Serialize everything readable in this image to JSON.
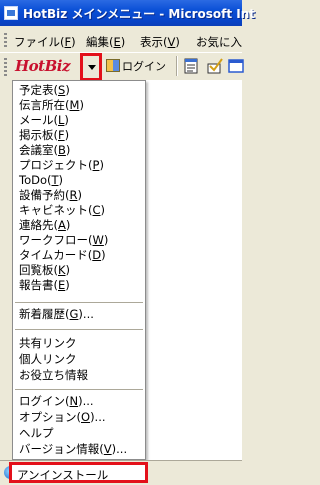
{
  "window": {
    "title": "HotBiz メインメニュー - Microsoft Int"
  },
  "menubar": {
    "items": [
      {
        "label": "ファイル(",
        "key": "F",
        "close": ")"
      },
      {
        "label": "編集(",
        "key": "E",
        "close": ")"
      },
      {
        "label": "表示(",
        "key": "V",
        "close": ")"
      },
      {
        "label": "お気に入",
        "key": "",
        "close": ""
      }
    ]
  },
  "toolbar": {
    "logo": "HotBiz",
    "login_label": "ログイン",
    "icons": [
      "notepad-icon",
      "check-icon",
      "window-icon"
    ]
  },
  "menu": {
    "groups": [
      [
        {
          "label": "予定表(",
          "key": "S",
          "close": ")"
        },
        {
          "label": "伝言所在(",
          "key": "M",
          "close": ")"
        },
        {
          "label": "メール(",
          "key": "L",
          "close": ")"
        },
        {
          "label": "掲示板(",
          "key": "F",
          "close": ")"
        },
        {
          "label": "会議室(",
          "key": "B",
          "close": ")"
        },
        {
          "label": "プロジェクト(",
          "key": "P",
          "close": ")"
        },
        {
          "label": "ToDo(",
          "key": "T",
          "close": ")"
        },
        {
          "label": "設備予約(",
          "key": "R",
          "close": ")"
        },
        {
          "label": "キャビネット(",
          "key": "C",
          "close": ")"
        },
        {
          "label": "連絡先(",
          "key": "A",
          "close": ")"
        },
        {
          "label": "ワークフロー(",
          "key": "W",
          "close": ")"
        },
        {
          "label": "タイムカード(",
          "key": "D",
          "close": ")"
        },
        {
          "label": "回覧板(",
          "key": "K",
          "close": ")"
        },
        {
          "label": "報告書(",
          "key": "E",
          "close": ")"
        }
      ],
      [
        {
          "label": "新着履歴(",
          "key": "G",
          "close": ")..."
        }
      ],
      [
        {
          "label": "共有リンク",
          "key": "",
          "close": ""
        },
        {
          "label": "個人リンク",
          "key": "",
          "close": ""
        },
        {
          "label": "お役立ち情報",
          "key": "",
          "close": ""
        }
      ],
      [
        {
          "label": "ログイン(",
          "key": "N",
          "close": ")..."
        },
        {
          "label": "オプション(",
          "key": "O",
          "close": ")..."
        },
        {
          "label": "ヘルプ",
          "key": "",
          "close": ""
        },
        {
          "label": "バージョン情報(",
          "key": "V",
          "close": ")..."
        }
      ],
      [
        {
          "label": "アンインストール",
          "key": "",
          "close": ""
        }
      ]
    ]
  },
  "colors": {
    "titlebar": "#0a4fd6",
    "highlight_box": "#e3101a",
    "logo": "#c8102e"
  }
}
